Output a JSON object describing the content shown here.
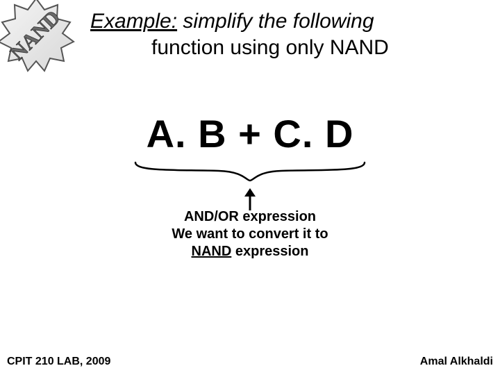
{
  "badge": {
    "text": "NAND"
  },
  "heading": {
    "label": "Example:",
    "rest1": " simplify the following",
    "line2": "function using only NAND"
  },
  "formula": "A. B  +  C. D",
  "annotation": {
    "line1": "AND/OR expression",
    "line2a": "We want to convert it to",
    "emph": "NAND",
    "line2b": " expression"
  },
  "footer": {
    "left": "CPIT 210 LAB, 2009",
    "right": "Amal Alkhaldi"
  }
}
